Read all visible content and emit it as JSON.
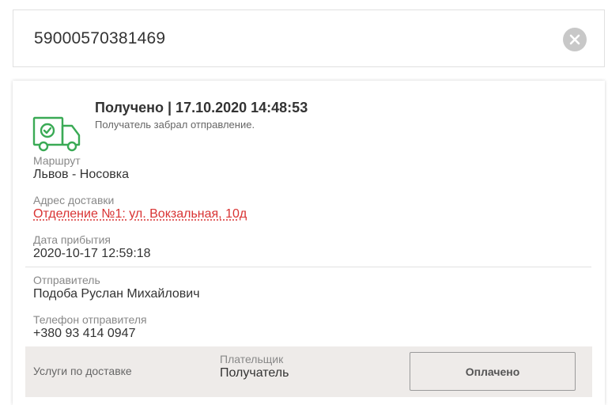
{
  "search": {
    "value": "59000570381469"
  },
  "status": {
    "title": "Получено | 17.10.2020 14:48:53",
    "subtitle": "Получатель забрал отправление."
  },
  "details": {
    "route_label": "Маршрут",
    "route_value": "Львов - Носовка",
    "address_label": "Адрес доставки",
    "address_value": "Отделение №1: ул. Вокзальная, 10д",
    "arrival_label": "Дата прибытия",
    "arrival_value": "2020-10-17 12:59:18"
  },
  "sender": {
    "name_label": "Отправитель",
    "name_value": "Подоба Руслан Михайлович",
    "phone_label": "Телефон отправителя",
    "phone_value": "+380 93 414 0947"
  },
  "footer": {
    "services_label": "Услуги по доставке",
    "payer_label": "Плательщик",
    "payer_value": "Получатель",
    "paid_button": "Оплачено"
  },
  "colors": {
    "accent_green": "#3aaa55",
    "link_red": "#d93333",
    "footer_bg": "#eeebe9"
  },
  "icons": {
    "clear": "close-icon",
    "status": "truck-icon"
  }
}
